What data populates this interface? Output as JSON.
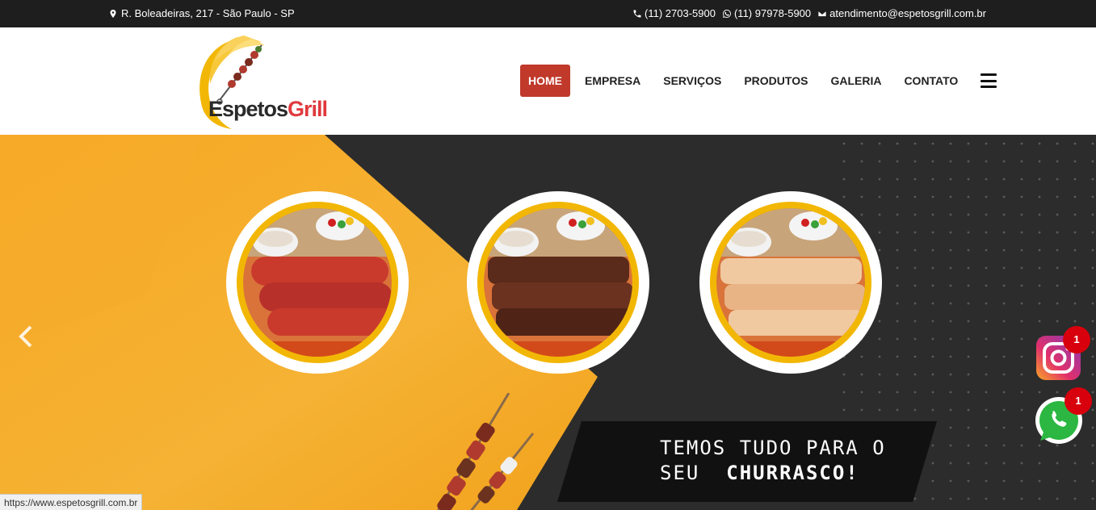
{
  "topbar": {
    "address": "R. Boleadeiras, 217 - São Paulo - SP",
    "phone": "(11) 2703-5900",
    "whatsapp": "(11) 97978-5900",
    "email": "atendimento@espetosgrill.com.br"
  },
  "logo": {
    "part1": "Espetos",
    "part2": "Grill"
  },
  "nav": {
    "items": [
      {
        "label": "HOME",
        "active": true
      },
      {
        "label": "EMPRESA"
      },
      {
        "label": "SERVIÇOS"
      },
      {
        "label": "PRODUTOS"
      },
      {
        "label": "GALERIA"
      },
      {
        "label": "CONTATO"
      }
    ],
    "menu_icon": "hamburger-icon"
  },
  "hero": {
    "line1": "TEMOS TUDO PARA O",
    "line2_prefix": "SEU",
    "line2_bold": "CHURRASCO!"
  },
  "social": {
    "instagram_count": "1",
    "whatsapp_count": "1"
  },
  "status_url": "https://www.espetosgrill.com.br",
  "colors": {
    "accent": "#c0392b",
    "orange": "#f5a623",
    "dark": "#1e1e1e"
  }
}
